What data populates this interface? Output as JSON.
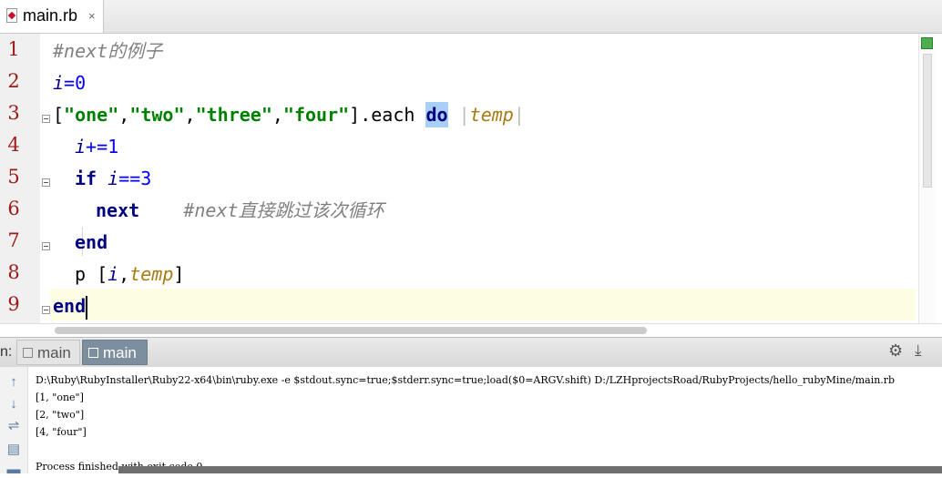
{
  "editor_tab": {
    "label": "main.rb",
    "close": "×"
  },
  "line_numbers": [
    "1",
    "2",
    "3",
    "4",
    "5",
    "6",
    "7",
    "8",
    "9"
  ],
  "code": {
    "l1_comment": "#next的例子",
    "l2_var": "i",
    "l2_op": "=",
    "l2_num": "0",
    "l3_open": "[",
    "l3_s1": "\"one\"",
    "l3_s2": "\"two\"",
    "l3_s3": "\"three\"",
    "l3_s4": "\"four\"",
    "l3_comma": ",",
    "l3_close_each": "].each ",
    "l3_do": "do",
    "l3_pipe": "|",
    "l3_param": "temp",
    "l4_var": "i",
    "l4_op": "+=",
    "l4_num": "1",
    "l5_if": "if",
    "l5_var": "i",
    "l5_op": "==",
    "l5_num": "3",
    "l6_next": "next",
    "l6_comment": "#next直接跳过该次循环",
    "l7_end": "end",
    "l8_p": "p [",
    "l8_var": "i",
    "l8_comma": ",",
    "l8_param": "temp",
    "l8_close": "]",
    "l9_end": "end"
  },
  "run_panel": {
    "label": "n:",
    "tabs": [
      {
        "label": "main"
      },
      {
        "label": "main"
      }
    ],
    "gear": "⚙",
    "minimize": "⤓"
  },
  "console": {
    "command": "D:\\Ruby\\RubyInstaller\\Ruby22-x64\\bin\\ruby.exe -e $stdout.sync=true;$stderr.sync=true;load($0=ARGV.shift) D:/LZHprojectsRoad/RubyProjects/hello_rubyMine/main.rb",
    "outputs": [
      "[1, \"one\"]",
      "[2, \"two\"]",
      "[4, \"four\"]"
    ],
    "finish": "Process finished with exit code 0"
  },
  "toolbar": {
    "up": "↑",
    "down": "↓",
    "wrap": "⇌",
    "print": "▤",
    "clear": "▬"
  },
  "colors": {
    "keyword": "#000080",
    "string": "#008000",
    "number": "#0000ff",
    "comment": "#808080",
    "block_param": "#a87a12"
  }
}
